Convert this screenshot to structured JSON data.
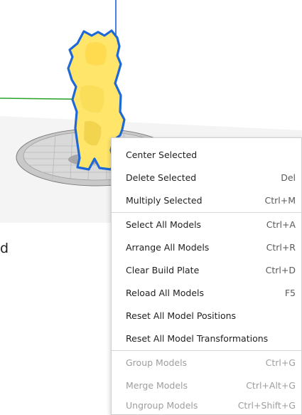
{
  "background_text": "d",
  "context_menu": {
    "items": [
      {
        "label": "Center Selected",
        "shortcut": ""
      },
      {
        "label": "Delete Selected",
        "shortcut": "Del"
      },
      {
        "label": "Multiply Selected",
        "shortcut": "Ctrl+M"
      },
      {
        "label": "Select All Models",
        "shortcut": "Ctrl+A"
      },
      {
        "label": "Arrange All Models",
        "shortcut": "Ctrl+R"
      },
      {
        "label": "Clear Build Plate",
        "shortcut": "Ctrl+D"
      },
      {
        "label": "Reload All Models",
        "shortcut": "F5"
      },
      {
        "label": "Reset All Model Positions",
        "shortcut": ""
      },
      {
        "label": "Reset All Model Transformations",
        "shortcut": ""
      },
      {
        "label": "Group Models",
        "shortcut": "Ctrl+G",
        "disabled": true
      },
      {
        "label": "Merge Models",
        "shortcut": "Ctrl+Alt+G",
        "disabled": true
      },
      {
        "label": "Ungroup Models",
        "shortcut": "Ctrl+Shift+G",
        "disabled": true
      }
    ]
  },
  "colors": {
    "model_fill": "#ffe66b",
    "model_outline": "#1f68d8",
    "build_plate": "#cfcfcf",
    "axis_x": "#e31d1d",
    "axis_y": "#2da52d",
    "axis_z": "#1f5fd6",
    "disabled_text": "#9e9e9e"
  }
}
